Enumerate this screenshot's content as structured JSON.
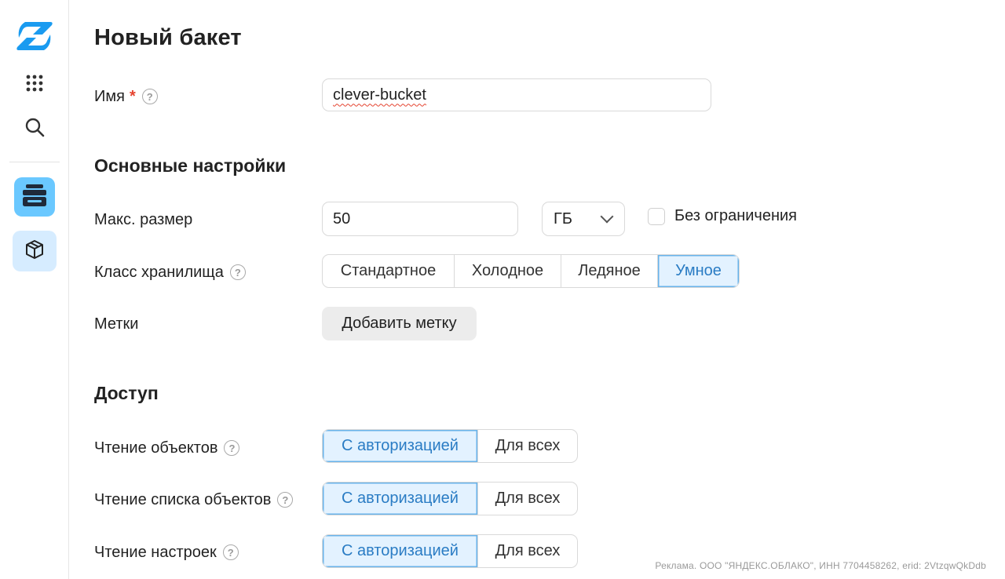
{
  "sidebar": {
    "icons": [
      "cloud-logo-icon",
      "apps-grid-icon",
      "search-icon",
      "storage-icon",
      "package-icon"
    ]
  },
  "page": {
    "title": "Новый бакет"
  },
  "name_field": {
    "label": "Имя",
    "required_mark": "*",
    "value": "clever-bucket"
  },
  "basic": {
    "title": "Основные настройки",
    "max_size": {
      "label": "Макс. размер",
      "value": "50",
      "unit": "ГБ",
      "no_limit_label": "Без ограничения",
      "no_limit_checked": false
    },
    "storage_class": {
      "label": "Класс хранилища",
      "options": [
        "Стандартное",
        "Холодное",
        "Ледяное",
        "Умное"
      ],
      "selected": "Умное"
    },
    "tags": {
      "label": "Метки",
      "button": "Добавить метку"
    }
  },
  "access": {
    "title": "Доступ",
    "rows": [
      {
        "label": "Чтение объектов",
        "options": [
          "С авторизацией",
          "Для всех"
        ],
        "selected": "С авторизацией"
      },
      {
        "label": "Чтение списка объектов",
        "options": [
          "С авторизацией",
          "Для всех"
        ],
        "selected": "С авторизацией"
      },
      {
        "label": "Чтение настроек",
        "options": [
          "С авторизацией",
          "Для всех"
        ],
        "selected": "С авторизацией"
      }
    ]
  },
  "ad_text": "Реклама. ООО \"ЯНДЕКС.ОБЛАКО\", ИНН 7704458262, erid: 2VtzqwQkDdb",
  "colors": {
    "accent": "#2a7cc4",
    "selected_bg": "#e3f2ff",
    "logo": "#1a9bf0",
    "required": "#e5432f"
  }
}
